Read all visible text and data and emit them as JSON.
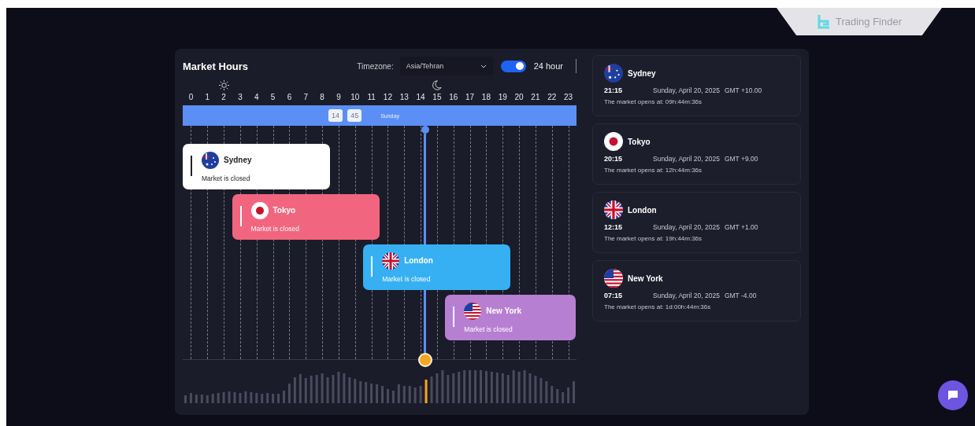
{
  "brand": {
    "name": "Trading Finder"
  },
  "panel": {
    "title": "Market Hours",
    "timezone_label": "Timezone:",
    "timezone": "Asia/Tehran",
    "clock_toggle": {
      "label": "24 hour",
      "on": true
    }
  },
  "hours": [
    "0",
    "1",
    "2",
    "3",
    "4",
    "5",
    "6",
    "7",
    "8",
    "9",
    "10",
    "11",
    "12",
    "13",
    "14",
    "15",
    "16",
    "17",
    "18",
    "19",
    "20",
    "21",
    "22",
    "23"
  ],
  "now_bar": {
    "hour": "14",
    "minute": "45",
    "day": "Sunday"
  },
  "scrubber": {
    "level": 0.615
  },
  "sessions": [
    {
      "name": "Sydney",
      "status": "Market is closed",
      "color": "#ffffff"
    },
    {
      "name": "Tokyo",
      "status": "Market is closed",
      "color": "#f2657f"
    },
    {
      "name": "London",
      "status": "Market is closed",
      "color": "#36b0f2"
    },
    {
      "name": "New York",
      "status": "Market is closed",
      "color": "#b77fd2"
    }
  ],
  "markets": [
    {
      "name": "Sydney",
      "time": "21:15",
      "date": "Sunday, April 20, 2025",
      "gmt": "GMT +10.00",
      "opens": "The market opens at: 09h:44m:36s"
    },
    {
      "name": "Tokyo",
      "time": "20:15",
      "date": "Sunday, April 20, 2025",
      "gmt": "GMT +9.00",
      "opens": "The market opens at: 12h:44m:36s"
    },
    {
      "name": "London",
      "time": "12:15",
      "date": "Sunday, April 20, 2025",
      "gmt": "GMT +1.00",
      "opens": "The market opens at: 19h:44m:36s"
    },
    {
      "name": "New York",
      "time": "07:15",
      "date": "Sunday, April 20, 2025",
      "gmt": "GMT -4.00",
      "opens": "The market opens at: 1d:00h:44m:36s"
    }
  ]
}
